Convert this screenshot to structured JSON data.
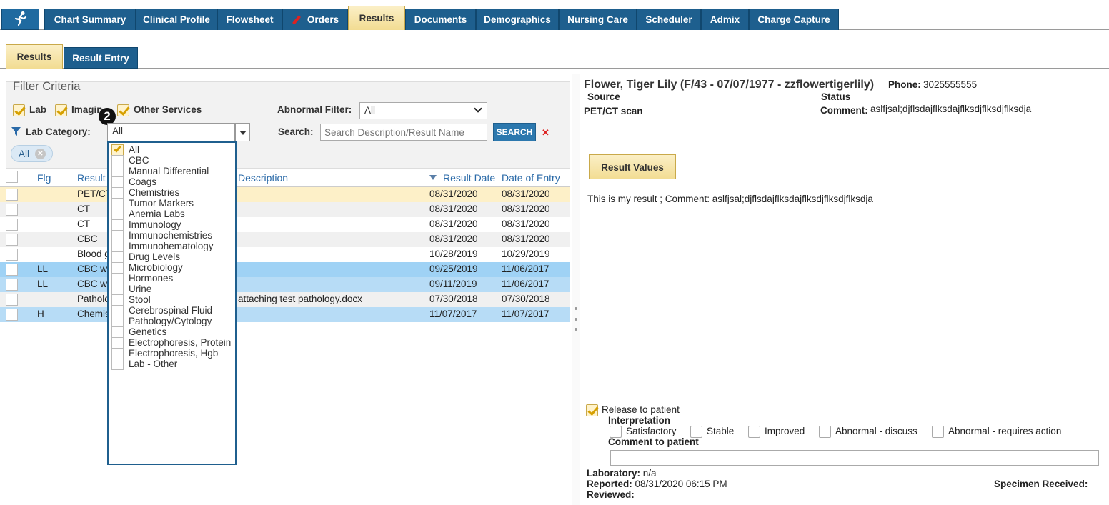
{
  "nav": {
    "tabs": [
      "Chart Summary",
      "Clinical Profile",
      "Flowsheet",
      "Orders",
      "Results",
      "Documents",
      "Demographics",
      "Nursing Care",
      "Scheduler",
      "Admix",
      "Charge Capture"
    ],
    "active": "Results"
  },
  "subtabs": {
    "results": "Results",
    "result_entry": "Result Entry"
  },
  "filter": {
    "title": "Filter Criteria",
    "lab": "Lab",
    "imaging": "Imaging",
    "other_services": "Other Services",
    "abnormal_label": "Abnormal Filter:",
    "abnormal_value": "All",
    "lab_category_label": "Lab Category:",
    "lab_category_value": "All",
    "search_label": "Search:",
    "search_placeholder": "Search Description/Result Name",
    "search_button": "SEARCH",
    "chip": "All",
    "step_badge": "2"
  },
  "grid": {
    "headers": {
      "flg": "Flg",
      "result": "Result",
      "description": "Description",
      "result_date": "Result Date",
      "date_of_entry": "Date of Entry"
    },
    "rows": [
      {
        "flg": "",
        "result": "PET/CT",
        "description": "",
        "result_date": "08/31/2020",
        "date_of_entry": "08/31/2020"
      },
      {
        "flg": "",
        "result": "CT",
        "description": "",
        "result_date": "08/31/2020",
        "date_of_entry": "08/31/2020"
      },
      {
        "flg": "",
        "result": "CT",
        "description": "",
        "result_date": "08/31/2020",
        "date_of_entry": "08/31/2020"
      },
      {
        "flg": "",
        "result": "CBC",
        "description": "",
        "result_date": "08/31/2020",
        "date_of_entry": "08/31/2020"
      },
      {
        "flg": "",
        "result": "Blood g",
        "description": "",
        "result_date": "10/28/2019",
        "date_of_entry": "10/29/2019"
      },
      {
        "flg": "LL",
        "result": "CBC w",
        "description": "",
        "result_date": "09/25/2019",
        "date_of_entry": "11/06/2017"
      },
      {
        "flg": "LL",
        "result": "CBC w",
        "description": "",
        "result_date": "09/11/2019",
        "date_of_entry": "11/06/2017"
      },
      {
        "flg": "",
        "result": "Patholo",
        "description": "attaching test pathology.docx",
        "result_date": "07/30/2018",
        "date_of_entry": "07/30/2018"
      },
      {
        "flg": "H",
        "result": "Chemis",
        "description": "",
        "result_date": "11/07/2017",
        "date_of_entry": "11/07/2017"
      }
    ]
  },
  "lab_category_options": [
    {
      "label": "All",
      "checked": true
    },
    {
      "label": "CBC",
      "checked": false
    },
    {
      "label": "Manual Differential",
      "checked": false
    },
    {
      "label": "Coags",
      "checked": false
    },
    {
      "label": "Chemistries",
      "checked": false
    },
    {
      "label": "Tumor Markers",
      "checked": false
    },
    {
      "label": "Anemia Labs",
      "checked": false
    },
    {
      "label": "Immunology",
      "checked": false
    },
    {
      "label": "Immunochemistries",
      "checked": false
    },
    {
      "label": "Immunohematology",
      "checked": false
    },
    {
      "label": "Drug Levels",
      "checked": false
    },
    {
      "label": "Microbiology",
      "checked": false
    },
    {
      "label": "Hormones",
      "checked": false
    },
    {
      "label": "Urine",
      "checked": false
    },
    {
      "label": "Stool",
      "checked": false
    },
    {
      "label": "Cerebrospinal Fluid",
      "checked": false
    },
    {
      "label": "Pathology/Cytology",
      "checked": false
    },
    {
      "label": "Genetics",
      "checked": false
    },
    {
      "label": "Electrophoresis, Protein",
      "checked": false
    },
    {
      "label": "Electrophoresis, Hgb",
      "checked": false
    },
    {
      "label": "Lab - Other",
      "checked": false
    }
  ],
  "patient": {
    "header": "Flower, Tiger Lily (F/43 - 07/07/1977 - zzflowertigerlily)",
    "phone_label": "Phone:",
    "phone": "3025555555",
    "source_label": "Source",
    "source": "PET/CT scan",
    "status_label": "Status",
    "comment_label": "Comment:",
    "comment": "aslfjsal;djflsdajflksdajflksdjflksdjflksdja"
  },
  "result_values": {
    "tab": "Result Values",
    "text": "This is my result ; Comment: aslfjsal;djflsdajflksdajflksdjflksdjflksdja"
  },
  "release": {
    "label": "Release to patient",
    "interpretation_label": "Interpretation",
    "options": [
      "Satisfactory",
      "Stable",
      "Improved",
      "Abnormal - discuss",
      "Abnormal - requires action"
    ],
    "comment_label": "Comment to patient"
  },
  "footer": {
    "laboratory_label": "Laboratory:",
    "laboratory": "n/a",
    "reported_label": "Reported:",
    "reported": "08/31/2020 06:15 PM",
    "reviewed_label": "Reviewed:",
    "specimen_label": "Specimen Received:"
  },
  "colors": {
    "nav_blue": "#1e5f8e",
    "active_tab": "#f2dc92",
    "row_highlight": "#fdf0c8",
    "row_selected": "#b7dcf6",
    "row_alt": "#f0f0f0"
  }
}
